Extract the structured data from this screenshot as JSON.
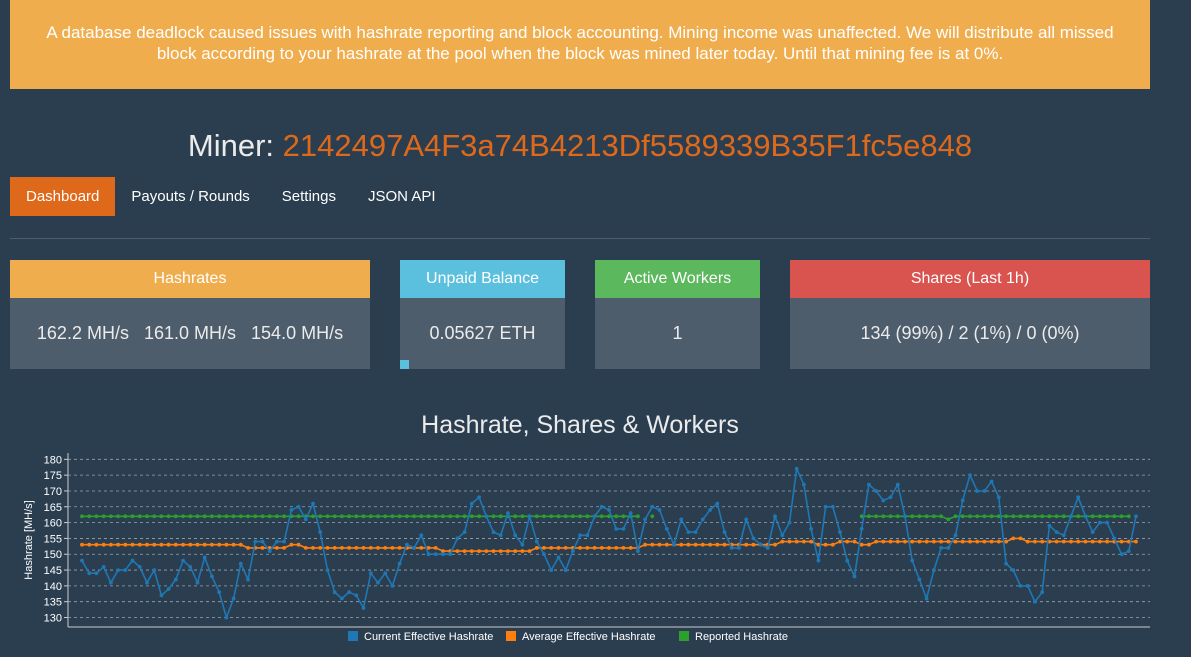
{
  "banner": {
    "text": "A database deadlock caused issues with hashrate reporting and block accounting. Mining income was unaffected. We will distribute all missed block according to your hashrate at the pool when the block was mined later today. Until that mining fee is at 0%."
  },
  "miner": {
    "label": "Miner:",
    "address": "2142497A4F3a74B4213Df5589339B35F1fc5e848"
  },
  "nav": {
    "tabs": [
      {
        "label": "Dashboard"
      },
      {
        "label": "Payouts / Rounds"
      },
      {
        "label": "Settings"
      },
      {
        "label": "JSON API"
      }
    ]
  },
  "cards": {
    "hashrates": {
      "title": "Hashrates",
      "values": [
        "162.2 MH/s",
        "161.0 MH/s",
        "154.0 MH/s"
      ],
      "color": "#f0ad4e"
    },
    "balance": {
      "title": "Unpaid Balance",
      "value": "0.05627 ETH",
      "progress": 0.056,
      "color": "#5bc0de"
    },
    "workers": {
      "title": "Active Workers",
      "value": "1",
      "color": "#5cb85c"
    },
    "shares": {
      "title": "Shares (Last 1h)",
      "value": "134 (99%) / 2 (1%) / 0 (0%)",
      "color": "#d9534f"
    }
  },
  "chart_title": "Hashrate, Shares & Workers",
  "chart_data": {
    "type": "line",
    "ylabel": "Hashrate [MH/s]",
    "ylim": [
      127,
      182
    ],
    "yticks": [
      130,
      135,
      140,
      145,
      150,
      155,
      160,
      165,
      170,
      175,
      180
    ],
    "grid": true,
    "legend_placement": "bottom",
    "series": [
      {
        "name": "Current Effective Hashrate",
        "color": "#1f77b4",
        "values": [
          148,
          144,
          144,
          146,
          141,
          145,
          145,
          148,
          146,
          141,
          145,
          137,
          139,
          142,
          148,
          146,
          141,
          149,
          143,
          138,
          130,
          136,
          147,
          142,
          154,
          154,
          151,
          154,
          154,
          164,
          165,
          161,
          166,
          157,
          145,
          138,
          136,
          138,
          137,
          133,
          144,
          141,
          144,
          140,
          147,
          153,
          152,
          156,
          150,
          150,
          150,
          150,
          155,
          157,
          166,
          168,
          162,
          157,
          156,
          163,
          156,
          153,
          162,
          154,
          150,
          145,
          149,
          145,
          151,
          156,
          156,
          162,
          165,
          164,
          158,
          158,
          163,
          151,
          161,
          165,
          164,
          158,
          153,
          161,
          157,
          157,
          161,
          164,
          166,
          157,
          152,
          152,
          161,
          155,
          153,
          152,
          162,
          156,
          160,
          177,
          172,
          158,
          148,
          165,
          165,
          157,
          148,
          143,
          158,
          172,
          170,
          167,
          168,
          172,
          162,
          148,
          142,
          136,
          145,
          152,
          152,
          156,
          167,
          175,
          170,
          170,
          173,
          168,
          147,
          145,
          140,
          140,
          135,
          138,
          159,
          157,
          156,
          162,
          168,
          162,
          157,
          160,
          160,
          155,
          150,
          151,
          162
        ]
      },
      {
        "name": "Average Effective Hashrate",
        "color": "#ff7f0e",
        "values": [
          153,
          153,
          153,
          153,
          153,
          153,
          153,
          153,
          153,
          153,
          153,
          153,
          153,
          153,
          153,
          153,
          153,
          153,
          153,
          153,
          153,
          153,
          153,
          152,
          152,
          152,
          152,
          152,
          152,
          153,
          153,
          152,
          152,
          152,
          152,
          152,
          152,
          152,
          152,
          152,
          152,
          152,
          152,
          152,
          152,
          152,
          152,
          152,
          152,
          152,
          151,
          151,
          151,
          151,
          151,
          151,
          151,
          151,
          151,
          151,
          151,
          151,
          151,
          152,
          152,
          152,
          152,
          152,
          152,
          152,
          152,
          152,
          152,
          152,
          152,
          152,
          152,
          152,
          153,
          153,
          153,
          153,
          153,
          153,
          153,
          153,
          153,
          153,
          153,
          153,
          153,
          153,
          153,
          153,
          153,
          153,
          153,
          154,
          154,
          154,
          154,
          154,
          153,
          153,
          153,
          154,
          154,
          154,
          153,
          153,
          154,
          154,
          154,
          154,
          154,
          154,
          154,
          154,
          154,
          154,
          154,
          154,
          154,
          154,
          154,
          154,
          154,
          154,
          154,
          155,
          155,
          154,
          154,
          154,
          154,
          154,
          154,
          154,
          154,
          154,
          154,
          154,
          154,
          154,
          154,
          154,
          154
        ]
      },
      {
        "name": "Reported Hashrate",
        "color": "#2ca02c",
        "values": [
          162,
          162,
          162,
          162,
          162,
          162,
          162,
          162,
          162,
          162,
          162,
          162,
          162,
          162,
          162,
          162,
          162,
          162,
          162,
          162,
          162,
          162,
          162,
          162,
          162,
          162,
          162,
          162,
          162,
          162,
          162,
          162,
          162,
          162,
          162,
          162,
          162,
          162,
          162,
          162,
          162,
          162,
          162,
          162,
          162,
          162,
          162,
          162,
          162,
          162,
          162,
          162,
          162,
          162,
          162,
          162,
          162,
          162,
          162,
          162,
          162,
          162,
          162,
          162,
          162,
          162,
          162,
          162,
          162,
          162,
          162,
          162,
          162,
          162,
          162,
          162,
          162,
          162,
          null,
          162,
          null,
          null,
          null,
          null,
          null,
          null,
          null,
          null,
          null,
          null,
          null,
          null,
          null,
          null,
          null,
          null,
          null,
          null,
          null,
          null,
          null,
          null,
          null,
          null,
          null,
          null,
          null,
          null,
          162,
          162,
          162,
          162,
          162,
          162,
          162,
          162,
          162,
          162,
          162,
          162,
          161,
          162,
          162,
          162,
          162,
          162,
          162,
          162,
          162,
          162,
          162,
          162,
          162,
          162,
          162,
          162,
          162,
          162,
          162,
          162,
          162,
          162,
          162,
          162,
          162,
          162
        ]
      }
    ]
  }
}
